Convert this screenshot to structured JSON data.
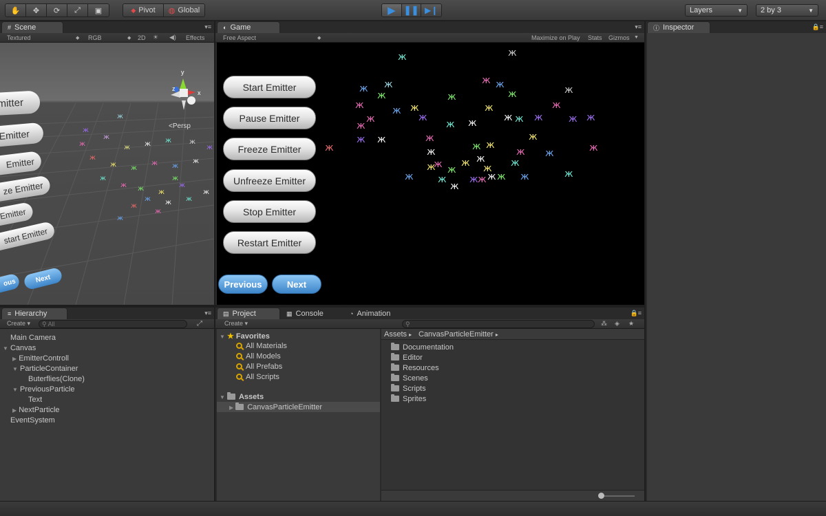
{
  "toolbar": {
    "pivot_label": "Pivot",
    "global_label": "Global",
    "layers_label": "Layers",
    "layout_label": "2 by 3"
  },
  "scene": {
    "tab": "Scene",
    "shading": "Textured",
    "render_mode": "RGB",
    "mode_2d": "2D",
    "effects": "Effects",
    "persp": "Persp",
    "axis_y": "y",
    "axis_x": "x",
    "axis_z": "z",
    "buttons": [
      "mitter",
      "Emitter",
      "Emitter",
      "ze Emitter",
      "p Emitter",
      "start Emitter"
    ],
    "prev": "ous",
    "next": "Next"
  },
  "game": {
    "tab": "Game",
    "aspect": "Free Aspect",
    "maximize": "Maximize on Play",
    "stats": "Stats",
    "gizmos": "Gizmos",
    "buttons": [
      "Start Emitter",
      "Pause Emitter",
      "Freeze Emitter",
      "Unfreeze Emitter",
      "Stop Emitter",
      "Restart Emitter"
    ],
    "previous": "Previous",
    "next": "Next"
  },
  "inspector": {
    "tab": "Inspector"
  },
  "hierarchy": {
    "tab": "Hierarchy",
    "create": "Create",
    "search_placeholder": "All",
    "items": [
      "Main Camera",
      "Canvas",
      "EmitterControll",
      "ParticleContainer",
      "Buterflies(Clone)",
      "PreviousParticle",
      "Text",
      "NextParticle",
      "EventSystem"
    ]
  },
  "project": {
    "tabs": [
      "Project",
      "Console",
      "Animation"
    ],
    "create": "Create",
    "favorites": "Favorites",
    "favorite_items": [
      "All Materials",
      "All Models",
      "All Prefabs",
      "All Scripts"
    ],
    "assets": "Assets",
    "asset_child": "CanvasParticleEmitter",
    "breadcrumb": [
      "Assets",
      "CanvasParticleEmitter"
    ],
    "folders": [
      "Documentation",
      "Editor",
      "Resources",
      "Scenes",
      "Scripts",
      "Sprites"
    ]
  },
  "colors": {
    "play_blue": "#3a8fe0",
    "butterfly_palette": [
      "#e86ab6",
      "#6ee8d2",
      "#f0e36c",
      "#9b6cf0",
      "#7ce86a",
      "#f0f0f0",
      "#6aa6f0",
      "#e86a6a"
    ]
  }
}
